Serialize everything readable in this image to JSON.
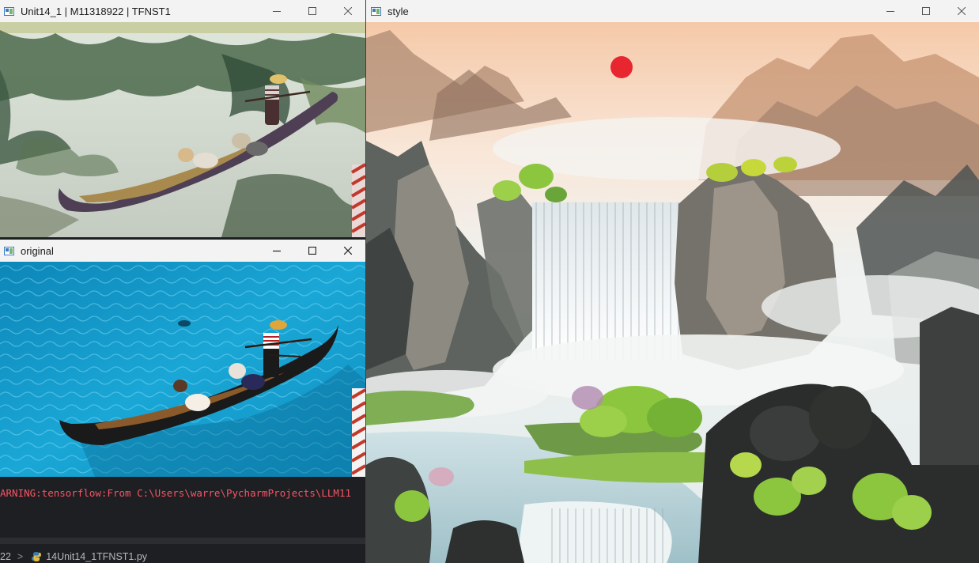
{
  "windows": {
    "stylized": {
      "title": "Unit14_1 | M11318922 | TFNST1"
    },
    "original": {
      "title": "original"
    },
    "style": {
      "title": "style"
    }
  },
  "console": {
    "warning": "ARNING:tensorflow:From C:\\Users\\warre\\PycharmProjects\\LLM11",
    "breadcrumb": {
      "prefix": "22",
      "separator": ">",
      "file": "14Unit14_1TFNST1.py"
    }
  },
  "colors": {
    "warning": "#f75464",
    "titlebar": "#f3f3f3",
    "console_bg": "#1e1f22",
    "water": "#1aa7d6"
  },
  "icons": [
    "app-icon",
    "minimize-icon",
    "maximize-icon",
    "close-icon",
    "python-file-icon"
  ]
}
